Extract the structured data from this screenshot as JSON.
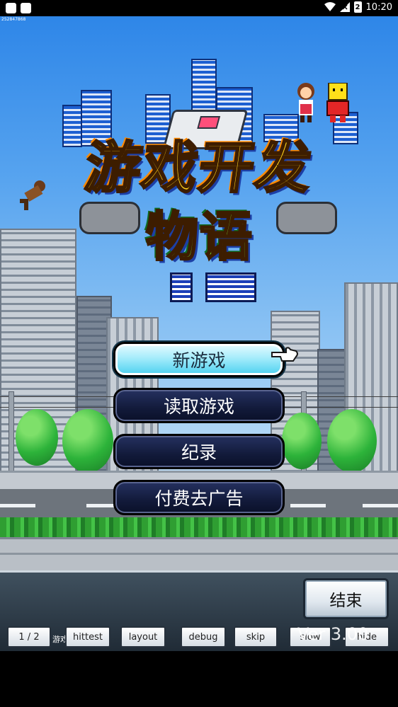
{
  "status_bar": {
    "time": "10:20",
    "battery_level": "2"
  },
  "tiny_label": "252847868",
  "menu": {
    "new_game": "新游戏",
    "load_game": "读取游戏",
    "records": "纪录",
    "remove_ads": "付费去广告"
  },
  "end_button": "结束",
  "debug": {
    "page": "1 / 2",
    "hittest": "hittest",
    "layout": "layout",
    "debug": "debug",
    "skip": "skip",
    "slow": "slow",
    "hide": "hide",
    "game_label": "游戏"
  },
  "version": "Ver 3.00",
  "colors": {
    "sky": "#56a3ef",
    "menu_dark": "#121a3a",
    "menu_selected": "#a5ecfb"
  }
}
